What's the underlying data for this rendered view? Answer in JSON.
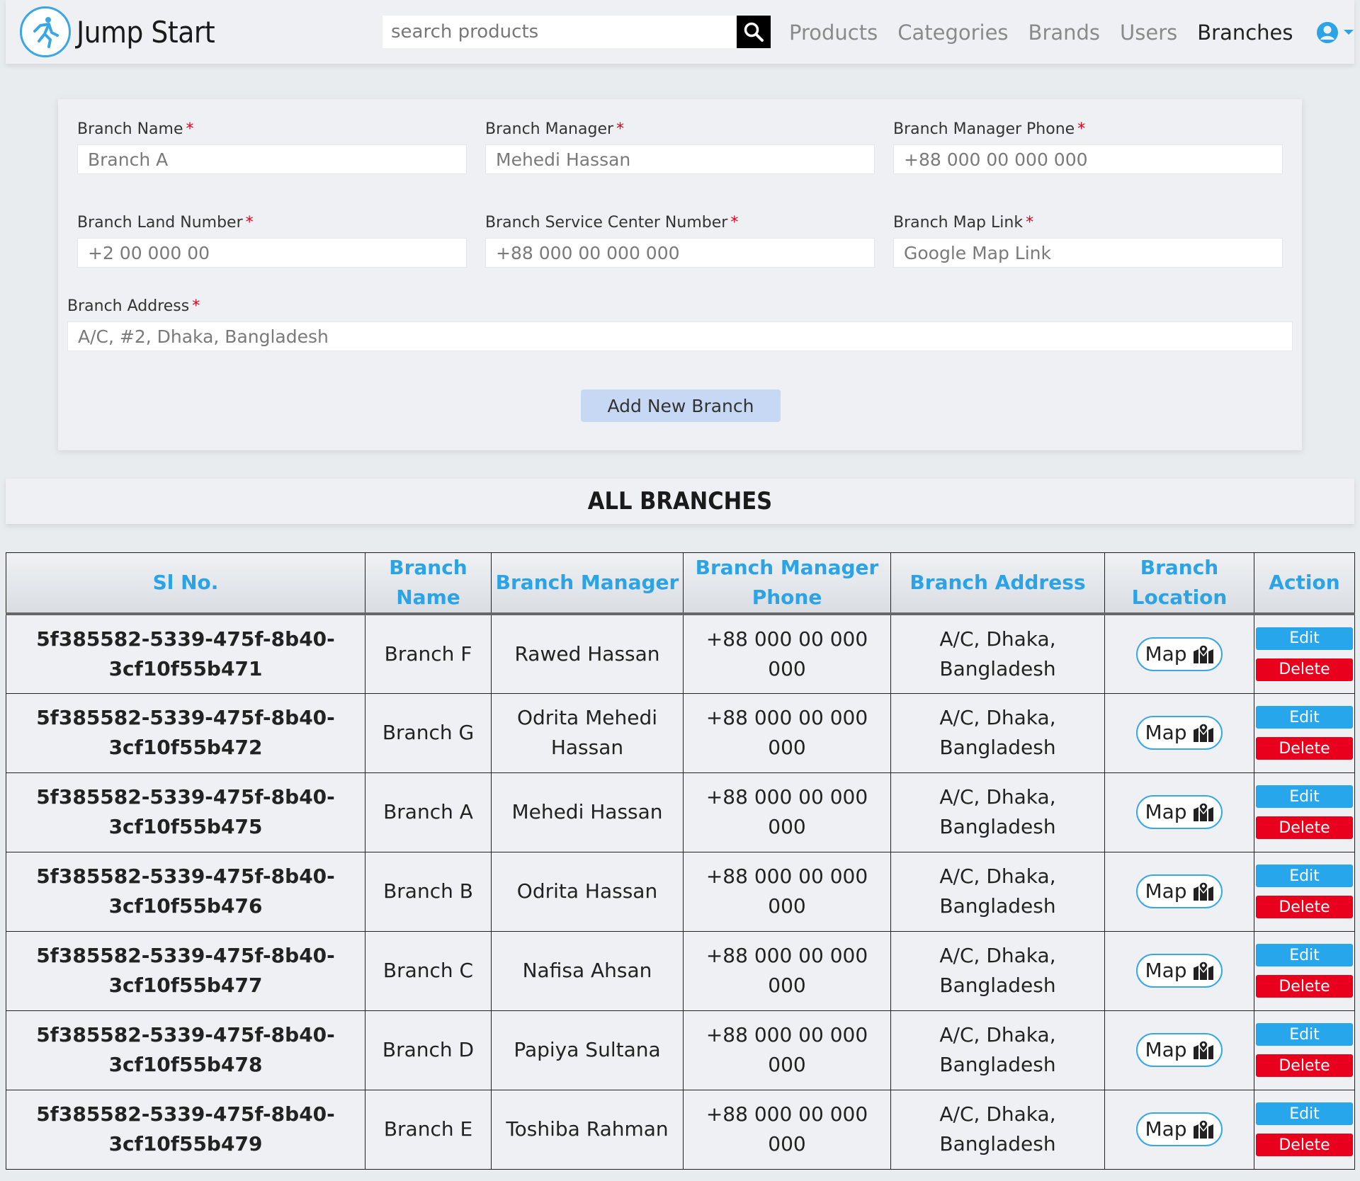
{
  "navbar": {
    "brand": "Jump Start",
    "search_placeholder": "search products",
    "links": [
      {
        "label": "Products",
        "active": false
      },
      {
        "label": "Categories",
        "active": false
      },
      {
        "label": "Brands",
        "active": false
      },
      {
        "label": "Users",
        "active": false
      },
      {
        "label": "Branches",
        "active": true
      }
    ]
  },
  "form": {
    "branch_name": {
      "label": "Branch Name",
      "placeholder": "Branch A"
    },
    "branch_manager": {
      "label": "Branch Manager",
      "placeholder": "Mehedi Hassan"
    },
    "manager_phone": {
      "label": "Branch Manager Phone",
      "placeholder": "+88 000 00 000 000"
    },
    "land_number": {
      "label": "Branch Land Number",
      "placeholder": "+2 00 000 00"
    },
    "service_number": {
      "label": "Branch Service Center Number",
      "placeholder": "+88 000 00 000 000"
    },
    "map_link": {
      "label": "Branch Map Link",
      "placeholder": "Google Map Link"
    },
    "address": {
      "label": "Branch Address",
      "placeholder": "A/C, #2, Dhaka, Bangladesh"
    },
    "required_mark": "*",
    "submit_label": "Add New Branch"
  },
  "all_branches_title": "ALL BRANCHES",
  "table": {
    "headers": [
      "Sl No.",
      "Branch Name",
      "Branch Manager",
      "Branch Manager Phone",
      "Branch Address",
      "Branch Location",
      "Action"
    ],
    "map_label": "Map",
    "edit_label": "Edit",
    "delete_label": "Delete",
    "rows": [
      {
        "id": "5f385582-5339-475f-8b40-3cf10f55b471",
        "name": "Branch F",
        "manager": "Rawed Hassan",
        "phone": "+88 000 00 000 000",
        "address": "A/C, Dhaka, Bangladesh"
      },
      {
        "id": "5f385582-5339-475f-8b40-3cf10f55b472",
        "name": "Branch G",
        "manager": "Odrita Mehedi Hassan",
        "phone": "+88 000 00 000 000",
        "address": "A/C, Dhaka, Bangladesh"
      },
      {
        "id": "5f385582-5339-475f-8b40-3cf10f55b475",
        "name": "Branch A",
        "manager": "Mehedi Hassan",
        "phone": "+88 000 00 000 000",
        "address": "A/C, Dhaka, Bangladesh"
      },
      {
        "id": "5f385582-5339-475f-8b40-3cf10f55b476",
        "name": "Branch B",
        "manager": "Odrita Hassan",
        "phone": "+88 000 00 000 000",
        "address": "A/C, Dhaka, Bangladesh"
      },
      {
        "id": "5f385582-5339-475f-8b40-3cf10f55b477",
        "name": "Branch C",
        "manager": "Nafisa Ahsan",
        "phone": "+88 000 00 000 000",
        "address": "A/C, Dhaka, Bangladesh"
      },
      {
        "id": "5f385582-5339-475f-8b40-3cf10f55b478",
        "name": "Branch D",
        "manager": "Papiya Sultana",
        "phone": "+88 000 00 000 000",
        "address": "A/C, Dhaka, Bangladesh"
      },
      {
        "id": "5f385582-5339-475f-8b40-3cf10f55b479",
        "name": "Branch E",
        "manager": "Toshiba Rahman",
        "phone": "+88 000 00 000 000",
        "address": "A/C, Dhaka, Bangladesh"
      }
    ]
  },
  "colors": {
    "accent": "#2ba3e4",
    "delete": "#e8001c",
    "required": "#e3001b",
    "add_button": "#c7d8f5"
  },
  "icons": {
    "logo": "runner-logo-icon",
    "search": "search-icon",
    "user": "user-circle-icon",
    "caret": "caret-down-icon",
    "map": "map-marked-icon"
  }
}
